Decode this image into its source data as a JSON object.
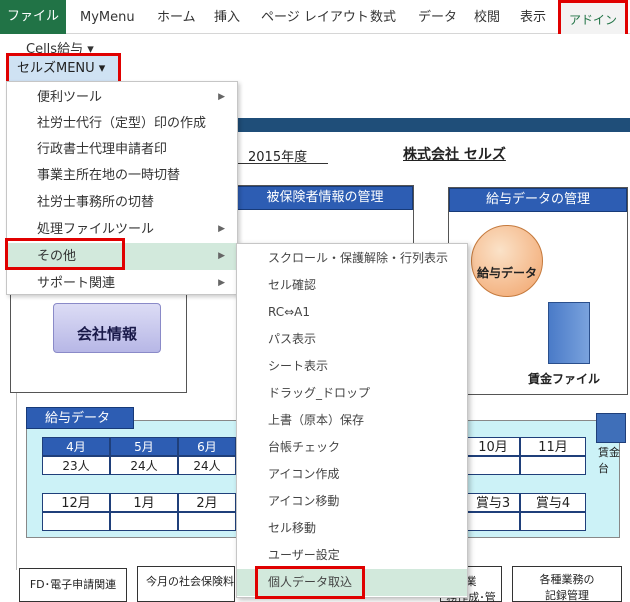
{
  "ribbon": {
    "tabs": [
      "ファイル",
      "MyMenu",
      "ホーム",
      "挿入",
      "ページ レイアウト",
      "数式",
      "データ",
      "校閲",
      "表示",
      "アドイン"
    ]
  },
  "addin_group": {
    "cells_kyuyo": "Cells給与 ▾",
    "seruzu_menu": "セルズMENU ▾"
  },
  "dropdown": {
    "items": [
      {
        "label": "便利ツール",
        "has_sub": true
      },
      {
        "label": "社労士代行（定型）印の作成",
        "has_sub": false
      },
      {
        "label": "行政書士代理申請者印",
        "has_sub": false
      },
      {
        "label": "事業主所在地の一時切替",
        "has_sub": false
      },
      {
        "label": "社労士事務所の切替",
        "has_sub": false
      },
      {
        "label": "処理ファイルツール",
        "has_sub": true
      },
      {
        "label": "その他",
        "has_sub": true
      },
      {
        "label": "サポート関連",
        "has_sub": true
      }
    ],
    "arrow": "▶"
  },
  "submenu": {
    "items": [
      "スクロール・保護解除・行列表示",
      "セル確認",
      "RC⇔A1",
      "パス表示",
      "シート表示",
      "ドラッグ_ドロップ",
      "上書（原本）保存",
      "台帳チェック",
      "アイコン作成",
      "アイコン移動",
      "セル移動",
      "ユーザー設定",
      "個人データ取込"
    ]
  },
  "sheet": {
    "year": "2015年度",
    "company": "株式会社 セルズ",
    "hihoken_title": "被保険者情報の管理",
    "kyuyo_title": "給与データの管理",
    "kyuyo_circle": "給与データ",
    "chingin_file": "賃金ファイル",
    "kaisha": "会社情報",
    "kyuyo_data_title": "給与データ",
    "months_row1": [
      "4月",
      "5月",
      "6月"
    ],
    "counts_row1": [
      "23人",
      "24人",
      "24人"
    ],
    "months_row1_right": [
      "10月",
      "11月"
    ],
    "months_row2": [
      "12月",
      "1月",
      "2月"
    ],
    "bonus_row2": [
      "賞与3",
      "賞与4"
    ],
    "chingin_dai": "賃金台",
    "bottom_buttons": [
      "FD･電子申請関連",
      "今月の社会保険料",
      "業\n務作成･管理",
      "各種業務の\n記録管理"
    ]
  },
  "colors": {
    "excel_green": "#217346",
    "highlight_red": "#e00000",
    "panel_blue": "#2d5db3",
    "light_cyan": "#ccf2f7",
    "menu_hover": "#d2e9dc"
  }
}
